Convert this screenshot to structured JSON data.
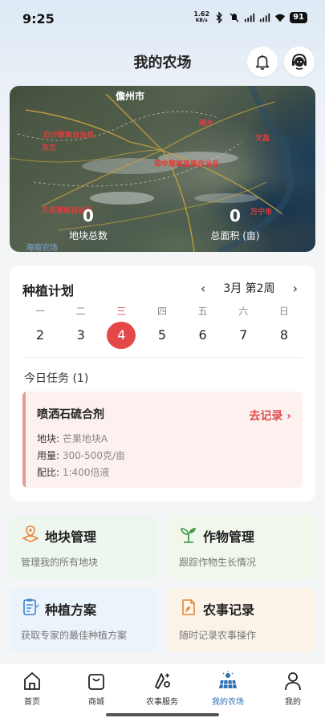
{
  "status_bar": {
    "time": "9:25",
    "net_speed_value": "1.62",
    "net_speed_unit": "KB/s",
    "battery": "91",
    "icons": [
      "bluetooth-icon",
      "mute-icon",
      "signal-5g-icon",
      "signal-5g-icon",
      "wifi-icon",
      "battery-icon"
    ]
  },
  "header": {
    "title": "我的农场",
    "icons": [
      "bell-icon",
      "customer-service-icon"
    ]
  },
  "map": {
    "labels": {
      "city_1": "儋州市",
      "city_2": "白沙黎族自治县",
      "city_3": "琼中黎族苗族自治县",
      "city_4": "乐东黎族自治县",
      "city_5": "万宁市",
      "city_6": "海南农场",
      "city_7": "陵水",
      "city_8": "文昌",
      "city_9": "东方"
    },
    "stats": [
      {
        "value": "0",
        "label": "地块总数"
      },
      {
        "value": "0",
        "label": "总面积 (亩)"
      }
    ]
  },
  "plan": {
    "title": "种植计划",
    "month_label": "3月 第2周",
    "prev_arrow": "‹",
    "next_arrow": "›",
    "weekdays": [
      "一",
      "二",
      "三",
      "四",
      "五",
      "六",
      "日"
    ],
    "days": [
      "2",
      "3",
      "4",
      "5",
      "6",
      "7",
      "8"
    ],
    "selected_index": 2,
    "tasks_heading": "今日任务 (1)",
    "task": {
      "name": "喷洒石硫合剂",
      "action": "去记录",
      "action_arrow": "›",
      "plot_label": "地块:",
      "plot_value": "芒果地块A",
      "dosage_label": "用量:",
      "dosage_value": "300-500克/亩",
      "ratio_label": "配比:",
      "ratio_value": "1:400倍液"
    }
  },
  "features": [
    {
      "title": "地块管理",
      "desc": "管理我的所有地块",
      "icon": "land-pin-icon"
    },
    {
      "title": "作物管理",
      "desc": "跟踪作物生长情况",
      "icon": "sprout-icon"
    },
    {
      "title": "种植方案",
      "desc": "获取专家的最佳种植方案",
      "icon": "clipboard-plan-icon"
    },
    {
      "title": "农事记录",
      "desc": "随时记录农事操作",
      "icon": "record-note-icon"
    }
  ],
  "bottom_nav": [
    {
      "label": "首页",
      "icon": "home-icon"
    },
    {
      "label": "商城",
      "icon": "shopping-bag-icon"
    },
    {
      "label": "农事服务",
      "icon": "farm-service-icon"
    },
    {
      "label": "我的农场",
      "icon": "farm-solar-icon",
      "active": true
    },
    {
      "label": "我的",
      "icon": "person-icon"
    }
  ],
  "colors": {
    "accent_red": "#e44747",
    "active_blue": "#2f6fb5",
    "tile_green": "#edf7ef",
    "tile_lime": "#f1f7ea",
    "tile_blue": "#ebf3fb",
    "tile_orange": "#fbf3e8"
  }
}
